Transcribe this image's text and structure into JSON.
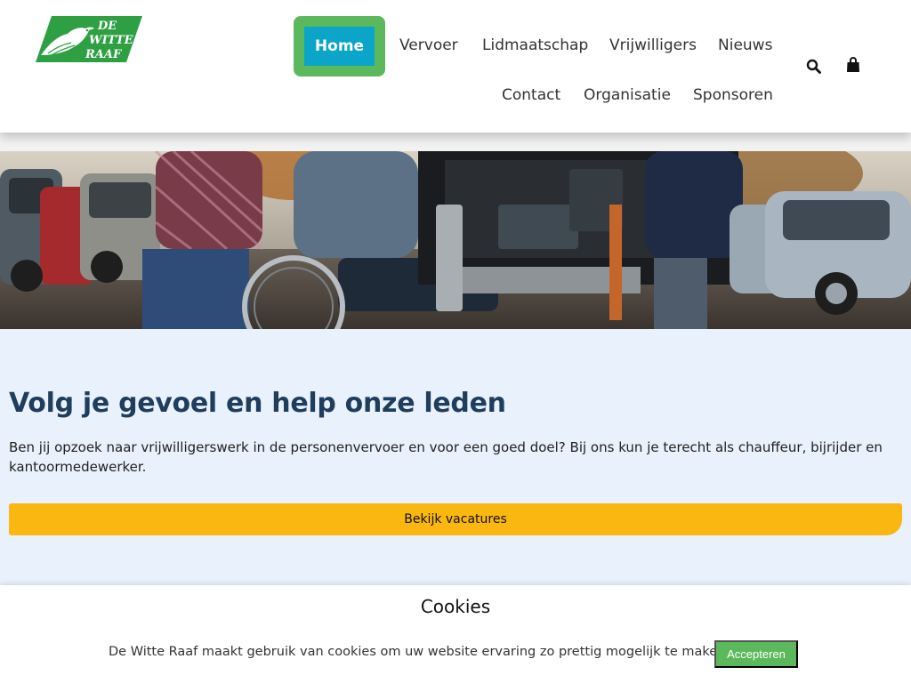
{
  "brand": {
    "logo_line1": "DE",
    "logo_line2": "WITTE",
    "logo_line3": "RAAF",
    "logo_color": "#2ea043"
  },
  "nav": {
    "home": "Home",
    "vervoer": "Vervoer",
    "lidmaatschap": "Lidmaatschap",
    "vrijwilligers": "Vrijwilligers",
    "nieuws": "Nieuws",
    "contact": "Contact",
    "organisatie": "Organisatie",
    "sponsoren": "Sponsoren",
    "search_icon": "search-icon",
    "cart_icon": "shopping-bag-icon"
  },
  "hero": {
    "image": "volunteers helping wheelchair user into accessible van"
  },
  "main": {
    "headline": "Volg je gevoel en help onze leden",
    "paragraph": "Ben jij opzoek naar vrijwilligerswerk in de personenvervoer en voor een goed doel? Bij ons kun je terecht als chauffeur, bijrijder en kantoormedewerker.",
    "cta_label": "Bekijk vacatures"
  },
  "cookie": {
    "title": "Cookies",
    "text": "De Witte Raaf maakt gebruik van cookies om uw website ervaring zo prettig mogelijk te maken.",
    "accept_label": "Accepteren"
  },
  "colors": {
    "accent_blue": "#0aa5c8",
    "accent_green": "#5cb85c",
    "cta_yellow": "#f9b710",
    "headline_navy": "#1f3d5c",
    "content_bg": "#e8f1fc"
  }
}
